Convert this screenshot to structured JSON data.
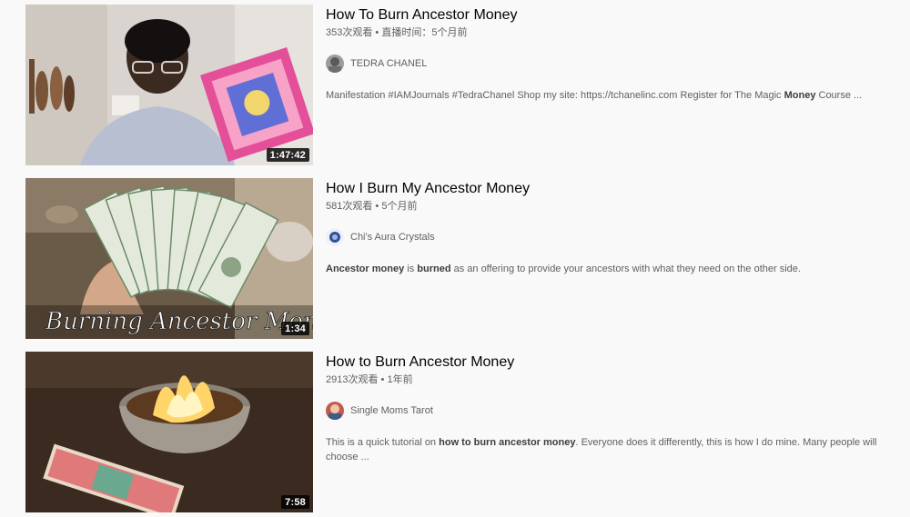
{
  "results": [
    {
      "title": "How To Burn Ancestor Money",
      "views": "353次观看",
      "extra": "直播时间：5个月前",
      "channel": "TEDRA CHANEL",
      "duration": "1:47:42",
      "description": [
        {
          "text": "Manifestation #IAMJournals #TedraChanel Shop my site: https://tchanelinc.com Register for The Magic ",
          "bold": false
        },
        {
          "text": "Money",
          "bold": true
        },
        {
          "text": " Course ...",
          "bold": false
        }
      ]
    },
    {
      "title": "How I Burn My Ancestor Money",
      "views": "581次观看",
      "extra": "5个月前",
      "channel": "Chi's Aura Crystals",
      "duration": "1:34",
      "thumb_text": "Burning Ancestor Money",
      "description": [
        {
          "text": "Ancestor money",
          "bold": true
        },
        {
          "text": " is ",
          "bold": false
        },
        {
          "text": "burned",
          "bold": true
        },
        {
          "text": " as an offering to provide your ancestors with what they need on the other side.",
          "bold": false
        }
      ]
    },
    {
      "title": "How to Burn Ancestor Money",
      "views": "2913次观看",
      "extra": "1年前",
      "channel": "Single Moms Tarot",
      "duration": "7:58",
      "description": [
        {
          "text": "This is a quick tutorial on ",
          "bold": false
        },
        {
          "text": "how to burn ancestor money",
          "bold": true
        },
        {
          "text": ". Everyone does it differently, this is how I do mine. Many people will choose ...",
          "bold": false
        }
      ]
    }
  ],
  "separator": " • "
}
